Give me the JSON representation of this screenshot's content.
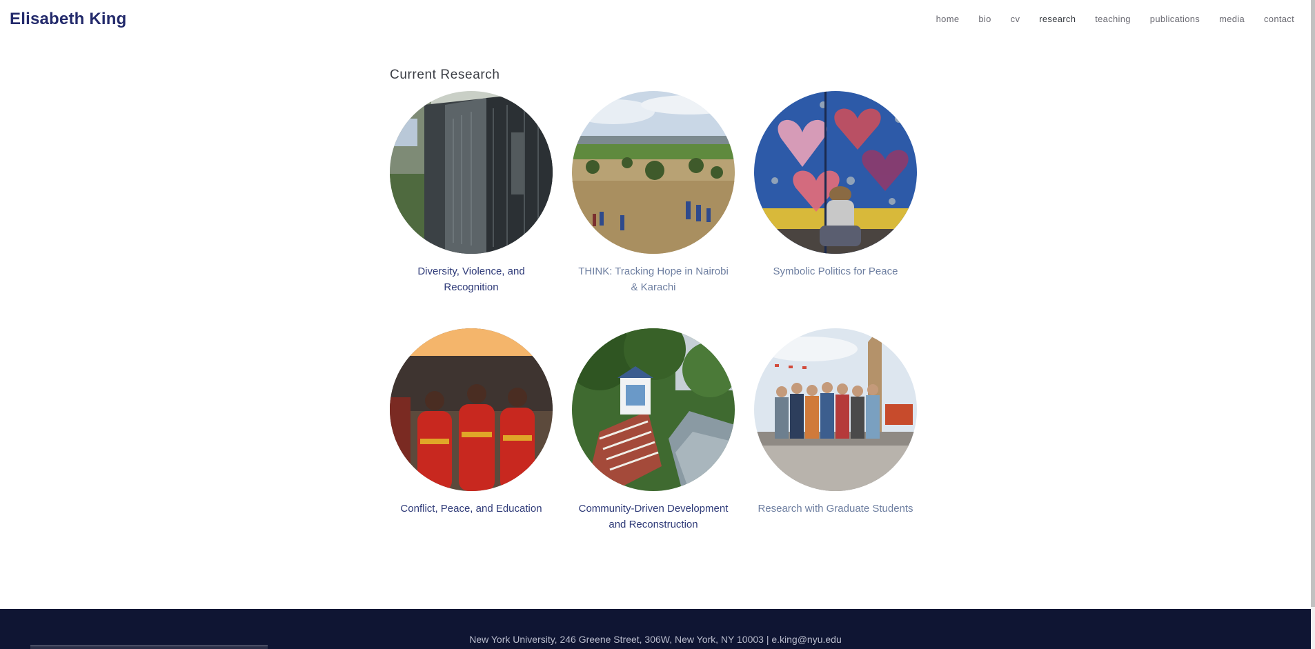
{
  "site": {
    "name": "Elisabeth King"
  },
  "nav": {
    "items": [
      {
        "label": "home"
      },
      {
        "label": "bio"
      },
      {
        "label": "cv"
      },
      {
        "label": "research"
      },
      {
        "label": "teaching"
      },
      {
        "label": "publications"
      },
      {
        "label": "media"
      },
      {
        "label": "contact"
      }
    ],
    "active": "research"
  },
  "main": {
    "section_title": "Current Research",
    "projects": [
      {
        "title": "Diversity, Violence, and Recognition",
        "image": "memorial-wall-photo"
      },
      {
        "title": "THINK: Tracking Hope in Nairobi & Karachi",
        "image": "field-landscape-photo"
      },
      {
        "title": "Symbolic Politics for Peace",
        "image": "heart-mural-photo"
      },
      {
        "title": "Conflict, Peace, and Education",
        "image": "dancers-photo"
      },
      {
        "title": "Community-Driven Development and Reconstruction",
        "image": "hillside-shrine-photo"
      },
      {
        "title": "Research with Graduate Students",
        "image": "group-photo"
      }
    ]
  },
  "footer": {
    "text": "New York University, 246 Greene Street, 306W, New York, NY 10003 | e.king@nyu.edu"
  },
  "colors": {
    "brand": "#232a6b",
    "link": "#2e3a78",
    "footer_bg": "#0f1533"
  }
}
